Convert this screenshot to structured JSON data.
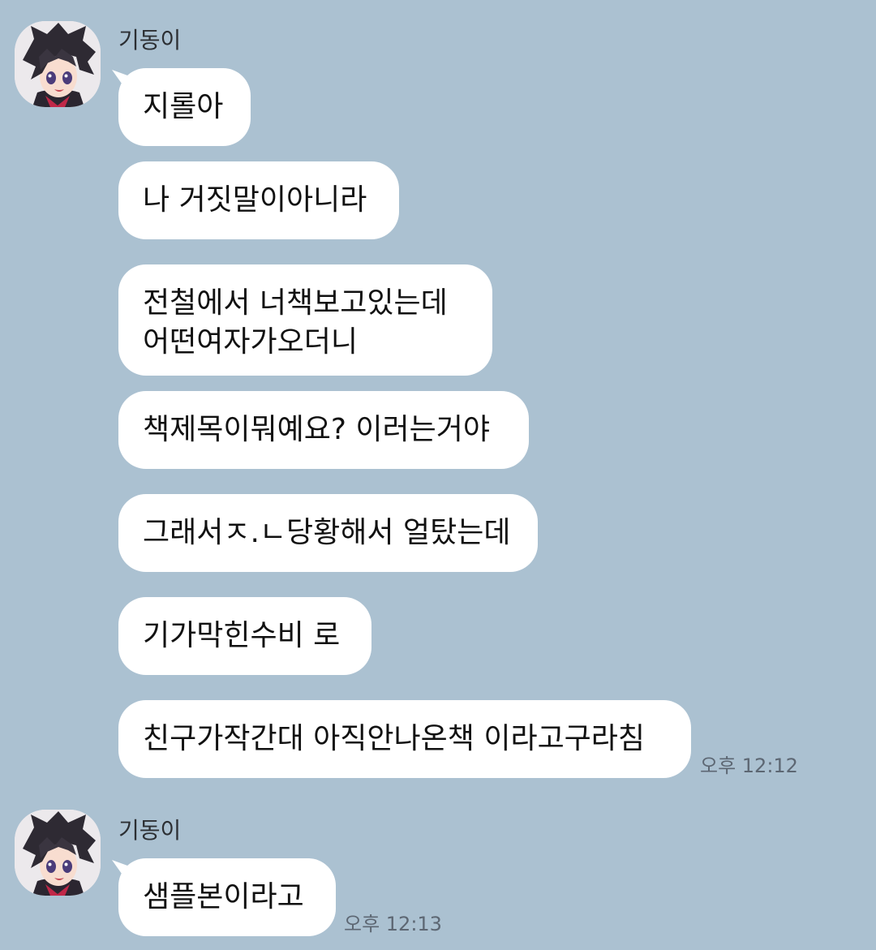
{
  "chat": {
    "groups": [
      {
        "sender": "기동이",
        "messages": [
          {
            "lines": [
              "지롤아"
            ]
          },
          {
            "lines": [
              "나 거짓말이아니라"
            ]
          },
          {
            "lines": [
              "전철에서 너책보고있는데",
              "어떤여자가오더니"
            ]
          },
          {
            "lines": [
              "책제목이뭐예요? 이러는거야"
            ]
          },
          {
            "lines": [
              "그래서ㅈ.ㄴ당황해서 얼탔는데"
            ]
          },
          {
            "lines": [
              "기가막힌수비 로"
            ]
          },
          {
            "lines": [
              "친구가작간대 아직안나온책 이라고구라침"
            ]
          }
        ],
        "time": "오후 12:12"
      },
      {
        "sender": "기동이",
        "messages": [
          {
            "lines": [
              "샘플본이라고"
            ]
          }
        ],
        "time": "오후 12:13"
      }
    ]
  }
}
